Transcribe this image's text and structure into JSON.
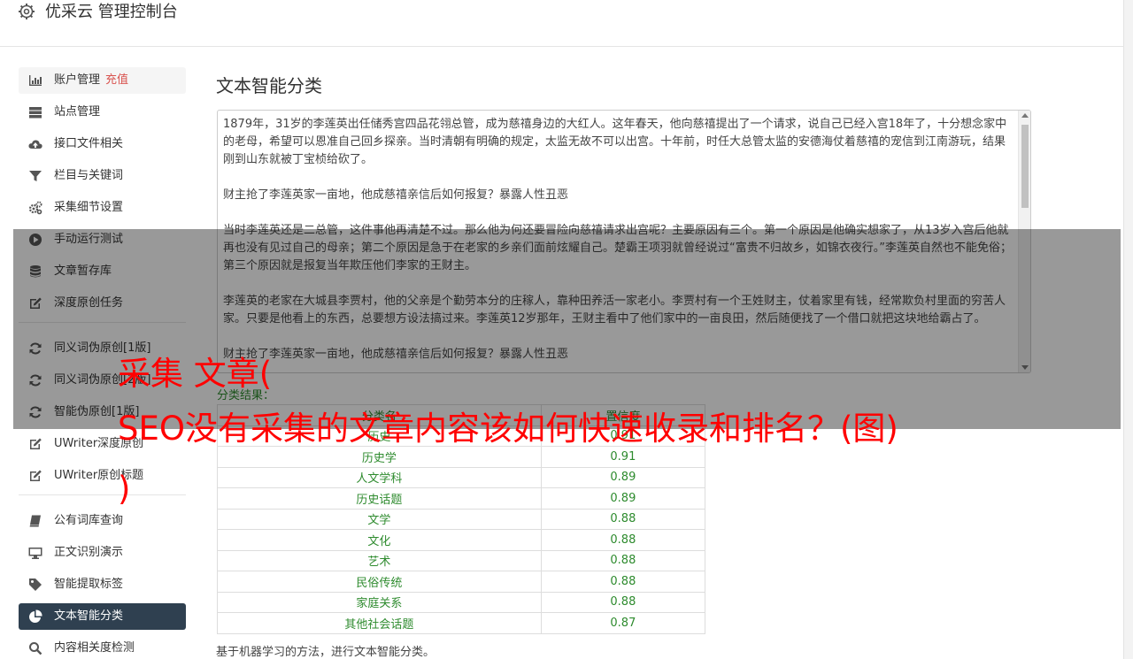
{
  "header": {
    "title": "优采云 管理控制台"
  },
  "sidebar": {
    "items": [
      {
        "label": "账户管理",
        "sub": "充值",
        "icon": "bar-chart-icon"
      },
      {
        "label": "站点管理",
        "icon": "server-icon"
      },
      {
        "label": "接口文件相关",
        "icon": "cloud-upload-icon"
      },
      {
        "label": "栏目与关键词",
        "icon": "filter-icon"
      },
      {
        "label": "采集细节设置",
        "icon": "cogs-icon"
      },
      {
        "label": "手动运行测试",
        "icon": "play-circle-icon"
      },
      {
        "label": "文章暂存库",
        "icon": "database-icon"
      },
      {
        "label": "深度原创任务",
        "icon": "edit-icon"
      },
      {
        "label": "同义词伪原创[1版]",
        "icon": "refresh-icon"
      },
      {
        "label": "同义词伪原创[2版]",
        "icon": "refresh-icon"
      },
      {
        "label": "智能伪原创[1版]",
        "icon": "refresh-icon"
      },
      {
        "label": "UWriter深度原创",
        "icon": "edit-icon"
      },
      {
        "label": "UWriter原创标题",
        "icon": "edit-icon"
      },
      {
        "label": "公有词库查询",
        "icon": "book-icon"
      },
      {
        "label": "正文识别演示",
        "icon": "desktop-icon"
      },
      {
        "label": "智能提取标签",
        "icon": "tag-icon"
      },
      {
        "label": "文本智能分类",
        "icon": "pie-chart-icon"
      },
      {
        "label": "内容相关度检测",
        "icon": "search-icon"
      }
    ]
  },
  "main": {
    "title": "文本智能分类",
    "text": "1879年，31岁的李莲英出任储秀宫四品花翎总管，成为慈禧身边的大红人。这年春天，他向慈禧提出了一个请求，说自己已经入宫18年了，十分想念家中的老母，希望可以恩准自己回乡探亲。当时清朝有明确的规定，太监无故不可以出宫。十年前，时任大总管太监的安德海仗着慈禧的宠信到江南游玩，结果刚到山东就被丁宝桢给砍了。\n\n财主抢了李莲英家一亩地，他成慈禧亲信后如何报复？暴露人性丑恶\n\n当时李莲英还是二总管，这件事他再清楚不过。那么他为何还要冒险向慈禧请求出宫呢？主要原因有三个。第一个原因是他确实想家了，从13岁入宫后他就再也没有见过自己的母亲；第二个原因是急于在老家的乡亲们面前炫耀自己。楚霸王项羽就曾经说过“富贵不归故乡，如锦衣夜行。”李莲英自然也不能免俗；第三个原因就是报复当年欺压他们李家的王财主。\n\n李莲英的老家在大城县李贾村，他的父亲是个勤劳本分的庄稼人，靠种田养活一家老小。李贾村有一个王姓财主，仗着家里有钱，经常欺负村里面的穷苦人家。只要是他看上的东西，总要想方设法搞过来。李莲英12岁那年，王财主看中了他们家中的一亩良田，然后随便找了一个借口就把这块地给霸占了。\n\n财主抢了李莲英家一亩地，他成慈禧亲信后如何报复？暴露人性丑恶",
    "result_label": "分类结果：",
    "table": {
      "headers": [
        "分类名",
        "置信度"
      ],
      "rows": [
        [
          "历史",
          "0.91"
        ],
        [
          "历史学",
          "0.91"
        ],
        [
          "人文学科",
          "0.89"
        ],
        [
          "历史话题",
          "0.89"
        ],
        [
          "文学",
          "0.88"
        ],
        [
          "文化",
          "0.88"
        ],
        [
          "艺术",
          "0.88"
        ],
        [
          "民俗传统",
          "0.88"
        ],
        [
          "家庭关系",
          "0.88"
        ],
        [
          "其他社会话题",
          "0.87"
        ]
      ]
    },
    "note": "基于机器学习的方法，进行文本智能分类。"
  },
  "banner": {
    "line1": "采集 文章(",
    "line2": "SEO没有采集的文章内容该如何快速收录和排名？(图)",
    "line3": ")"
  },
  "colors": {
    "active_bg": "#2f4050",
    "green": "#2e8b2e",
    "banner_red": "#ff0000",
    "recharge_red": "#d9534f"
  }
}
